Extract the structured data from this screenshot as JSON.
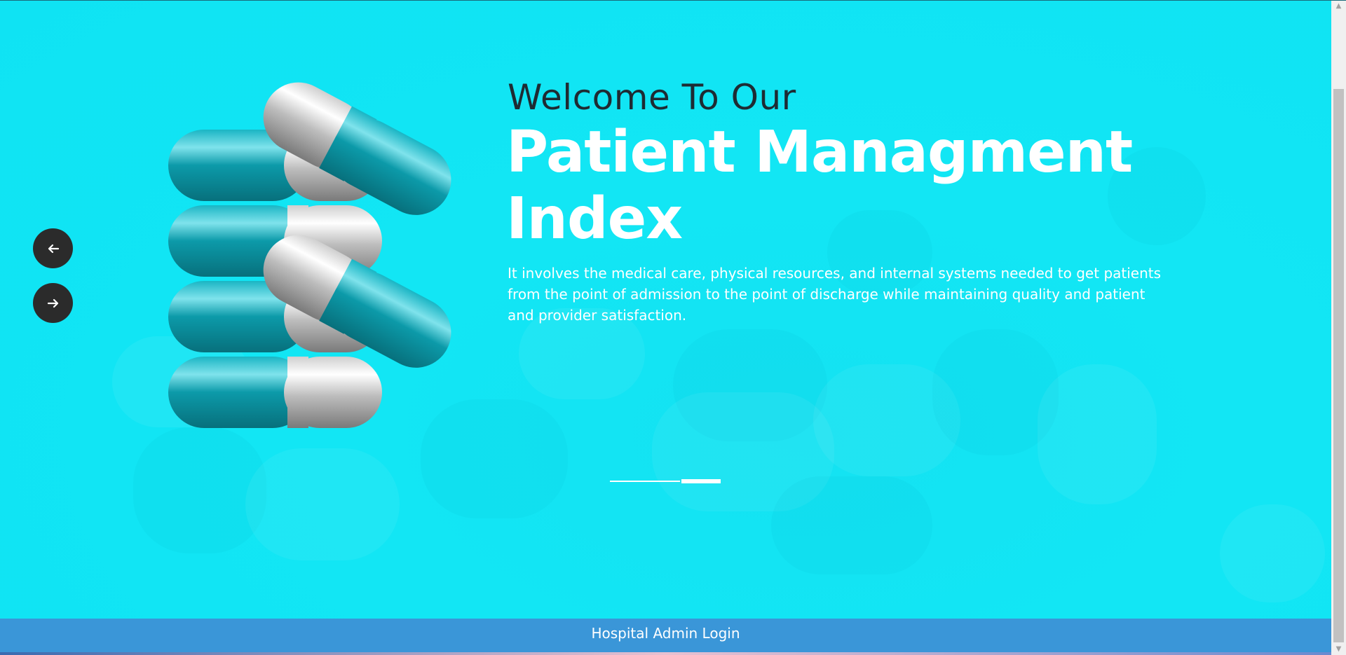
{
  "hero": {
    "welcome": "Welcome To Our",
    "title": "Patient Managment Index",
    "description": "It involves the medical care, physical resources, and internal systems needed to get patients from the point of admission to the point of discharge while maintaining quality and patient and provider satisfaction.",
    "prev_icon": "arrow-left-icon",
    "next_icon": "arrow-right-icon",
    "slides": {
      "count": 2,
      "active_index": 1
    }
  },
  "footer": {
    "login_link": "Hospital Admin Login"
  },
  "colors": {
    "background": "#12e6f4",
    "footer": "#3a96d8",
    "nav_button": "#2b2b2b",
    "pill_teal": "#0a9aa8",
    "pill_white": "#e0e0e0"
  }
}
